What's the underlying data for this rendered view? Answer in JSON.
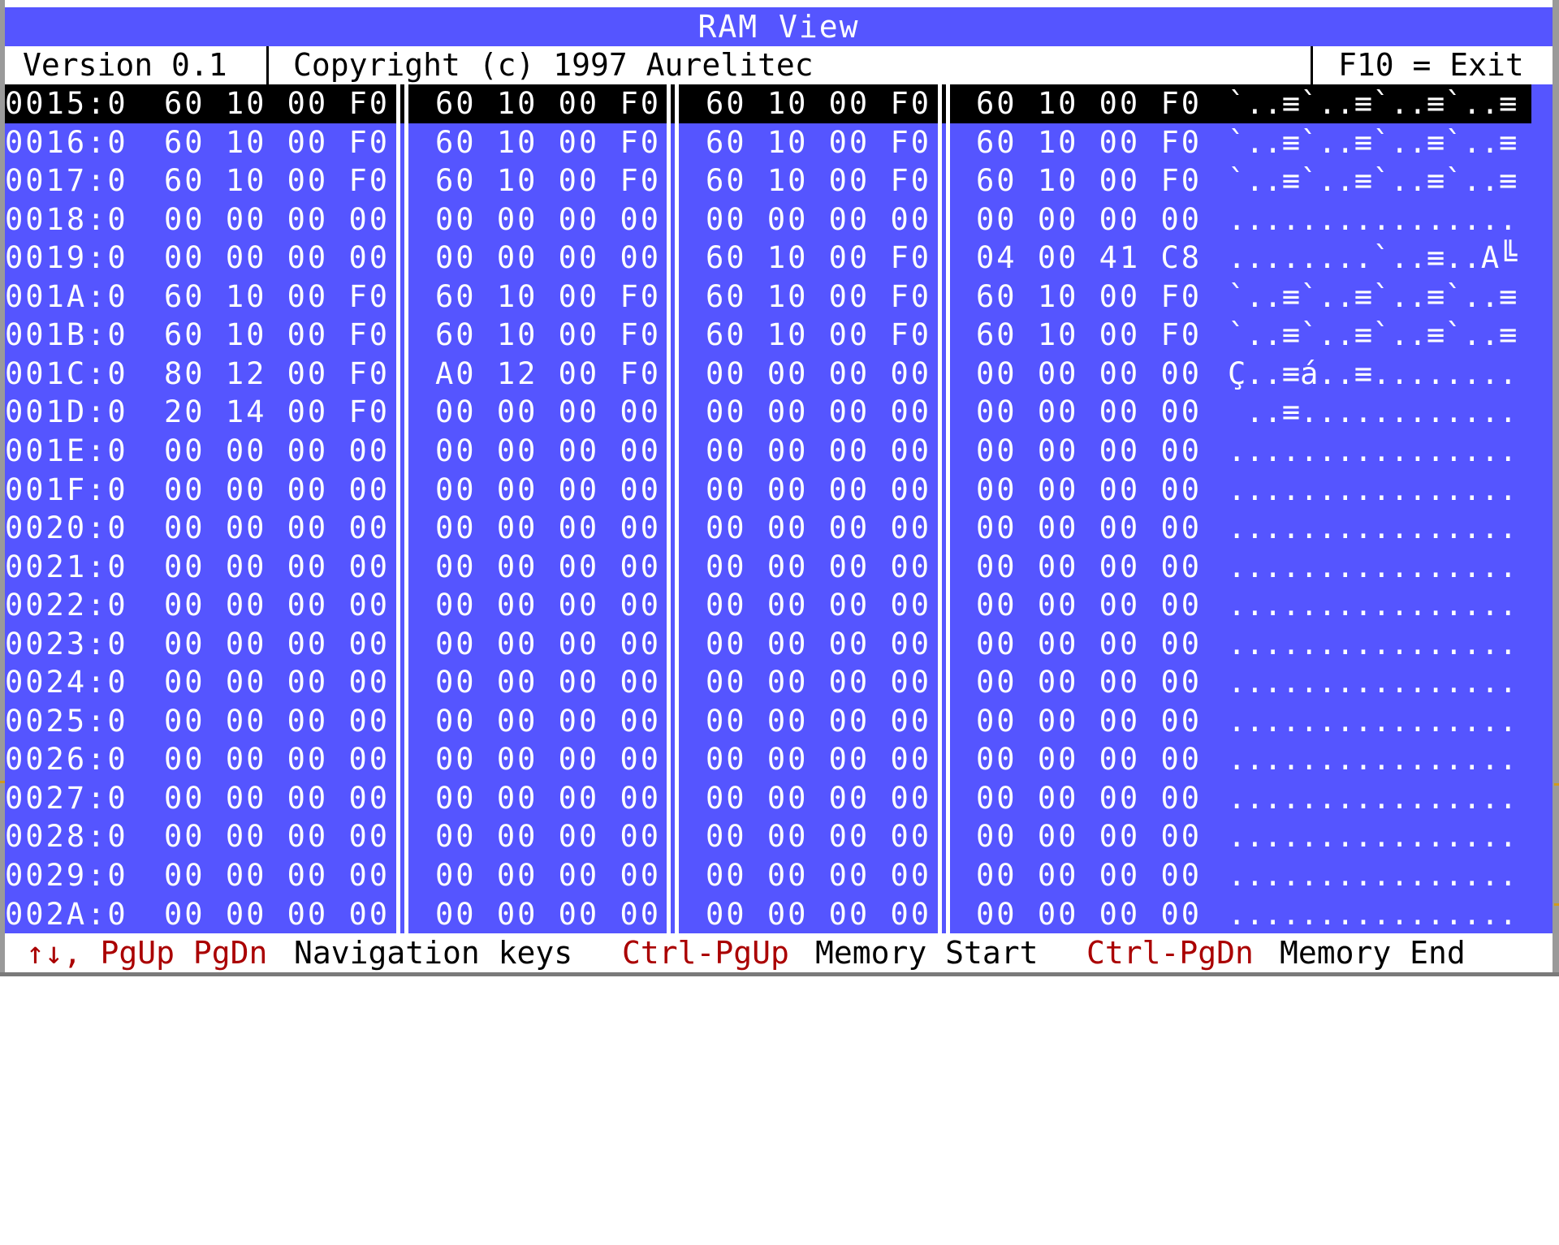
{
  "window": {
    "title": "RAM View"
  },
  "infobar": {
    "version": "Version 0.1",
    "copyright": "Copyright (c) 1997 Aurelitec",
    "exit_hint": "F10 = Exit"
  },
  "memory_view": {
    "selected_row_index": 0,
    "rows": [
      {
        "address": "0015:0",
        "groups": [
          "60 10 00 F0",
          "60 10 00 F0",
          "60 10 00 F0",
          "60 10 00 F0"
        ],
        "ascii": "`..≡`..≡`..≡`..≡"
      },
      {
        "address": "0016:0",
        "groups": [
          "60 10 00 F0",
          "60 10 00 F0",
          "60 10 00 F0",
          "60 10 00 F0"
        ],
        "ascii": "`..≡`..≡`..≡`..≡"
      },
      {
        "address": "0017:0",
        "groups": [
          "60 10 00 F0",
          "60 10 00 F0",
          "60 10 00 F0",
          "60 10 00 F0"
        ],
        "ascii": "`..≡`..≡`..≡`..≡"
      },
      {
        "address": "0018:0",
        "groups": [
          "00 00 00 00",
          "00 00 00 00",
          "00 00 00 00",
          "00 00 00 00"
        ],
        "ascii": "................"
      },
      {
        "address": "0019:0",
        "groups": [
          "00 00 00 00",
          "00 00 00 00",
          "60 10 00 F0",
          "04 00 41 C8"
        ],
        "ascii": "........`..≡..A╚"
      },
      {
        "address": "001A:0",
        "groups": [
          "60 10 00 F0",
          "60 10 00 F0",
          "60 10 00 F0",
          "60 10 00 F0"
        ],
        "ascii": "`..≡`..≡`..≡`..≡"
      },
      {
        "address": "001B:0",
        "groups": [
          "60 10 00 F0",
          "60 10 00 F0",
          "60 10 00 F0",
          "60 10 00 F0"
        ],
        "ascii": "`..≡`..≡`..≡`..≡"
      },
      {
        "address": "001C:0",
        "groups": [
          "80 12 00 F0",
          "A0 12 00 F0",
          "00 00 00 00",
          "00 00 00 00"
        ],
        "ascii": "Ç..≡á..≡........"
      },
      {
        "address": "001D:0",
        "groups": [
          "20 14 00 F0",
          "00 00 00 00",
          "00 00 00 00",
          "00 00 00 00"
        ],
        "ascii": " ..≡............"
      },
      {
        "address": "001E:0",
        "groups": [
          "00 00 00 00",
          "00 00 00 00",
          "00 00 00 00",
          "00 00 00 00"
        ],
        "ascii": "................"
      },
      {
        "address": "001F:0",
        "groups": [
          "00 00 00 00",
          "00 00 00 00",
          "00 00 00 00",
          "00 00 00 00"
        ],
        "ascii": "................"
      },
      {
        "address": "0020:0",
        "groups": [
          "00 00 00 00",
          "00 00 00 00",
          "00 00 00 00",
          "00 00 00 00"
        ],
        "ascii": "................"
      },
      {
        "address": "0021:0",
        "groups": [
          "00 00 00 00",
          "00 00 00 00",
          "00 00 00 00",
          "00 00 00 00"
        ],
        "ascii": "................"
      },
      {
        "address": "0022:0",
        "groups": [
          "00 00 00 00",
          "00 00 00 00",
          "00 00 00 00",
          "00 00 00 00"
        ],
        "ascii": "................"
      },
      {
        "address": "0023:0",
        "groups": [
          "00 00 00 00",
          "00 00 00 00",
          "00 00 00 00",
          "00 00 00 00"
        ],
        "ascii": "................"
      },
      {
        "address": "0024:0",
        "groups": [
          "00 00 00 00",
          "00 00 00 00",
          "00 00 00 00",
          "00 00 00 00"
        ],
        "ascii": "................"
      },
      {
        "address": "0025:0",
        "groups": [
          "00 00 00 00",
          "00 00 00 00",
          "00 00 00 00",
          "00 00 00 00"
        ],
        "ascii": "................"
      },
      {
        "address": "0026:0",
        "groups": [
          "00 00 00 00",
          "00 00 00 00",
          "00 00 00 00",
          "00 00 00 00"
        ],
        "ascii": "................"
      },
      {
        "address": "0027:0",
        "groups": [
          "00 00 00 00",
          "00 00 00 00",
          "00 00 00 00",
          "00 00 00 00"
        ],
        "ascii": "................"
      },
      {
        "address": "0028:0",
        "groups": [
          "00 00 00 00",
          "00 00 00 00",
          "00 00 00 00",
          "00 00 00 00"
        ],
        "ascii": "................"
      },
      {
        "address": "0029:0",
        "groups": [
          "00 00 00 00",
          "00 00 00 00",
          "00 00 00 00",
          "00 00 00 00"
        ],
        "ascii": "................"
      },
      {
        "address": "002A:0",
        "groups": [
          "00 00 00 00",
          "00 00 00 00",
          "00 00 00 00",
          "00 00 00 00"
        ],
        "ascii": "................"
      }
    ]
  },
  "footer": {
    "nav_keys": "↑↓, PgUp PgDn",
    "nav_desc": "Navigation keys",
    "start_key": "Ctrl-PgUp",
    "start_desc": "Memory Start",
    "end_key": "Ctrl-PgDn",
    "end_desc": "Memory End"
  },
  "colors": {
    "background_blue": "#5555ff",
    "selection": "#000000",
    "text": "#ffffff",
    "key_red": "#aa0000",
    "bar_white": "#ffffff"
  }
}
